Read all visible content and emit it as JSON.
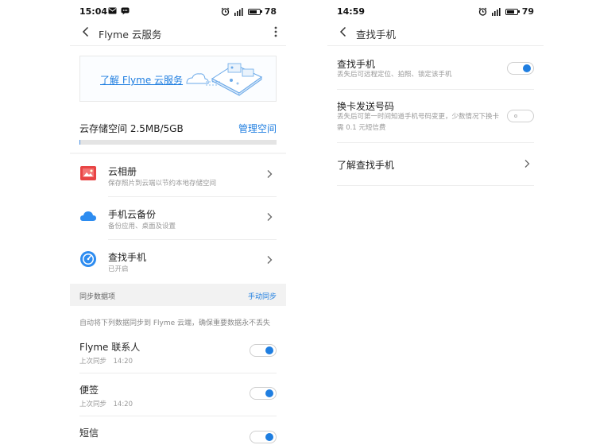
{
  "left": {
    "status": {
      "time": "15:04",
      "battery": "78",
      "battery_level": 0.78
    },
    "nav": {
      "title": "Flyme 云服务"
    },
    "banner": {
      "link": "了解 Flyme 云服务"
    },
    "storage": {
      "label": "云存储空间 2.5MB/5GB",
      "manage": "管理空间",
      "used_fraction": 0.0005
    },
    "services": [
      {
        "title": "云相册",
        "subtitle": "保存照片到云端以节约本地存储空间",
        "icon": "photo-album-icon"
      },
      {
        "title": "手机云备份",
        "subtitle": "备份应用、桌面及设置",
        "icon": "cloud-icon"
      },
      {
        "title": "查找手机",
        "subtitle": "已开启",
        "icon": "find-phone-icon"
      }
    ],
    "sync_section": {
      "title": "同步数据项",
      "action": "手动同步",
      "description": "自动将下列数据同步到 Flyme 云端，确保重要数据永不丢失"
    },
    "sync_items": [
      {
        "title": "Flyme 联系人",
        "subtitle": "上次同步　14:20",
        "enabled": true
      },
      {
        "title": "便签",
        "subtitle": "上次同步　14:20",
        "enabled": true
      },
      {
        "title": "短信",
        "subtitle": "",
        "enabled": true
      }
    ]
  },
  "right": {
    "status": {
      "time": "14:59",
      "battery": "79",
      "battery_level": 0.79
    },
    "nav": {
      "title": "查找手机"
    },
    "items": [
      {
        "title": "查找手机",
        "subtitle": "丢失后可远程定位、拍照、锁定该手机",
        "enabled": true
      },
      {
        "title": "换卡发送号码",
        "subtitle": "丢失后可第一时间知道手机号码变更，少数情况下换卡需 0.1 元短信费",
        "enabled": false
      },
      {
        "title": "了解查找手机"
      }
    ]
  },
  "colors": {
    "accent": "#1f7ee0",
    "divider": "#ececec",
    "section_bg": "#f2f2f2"
  }
}
